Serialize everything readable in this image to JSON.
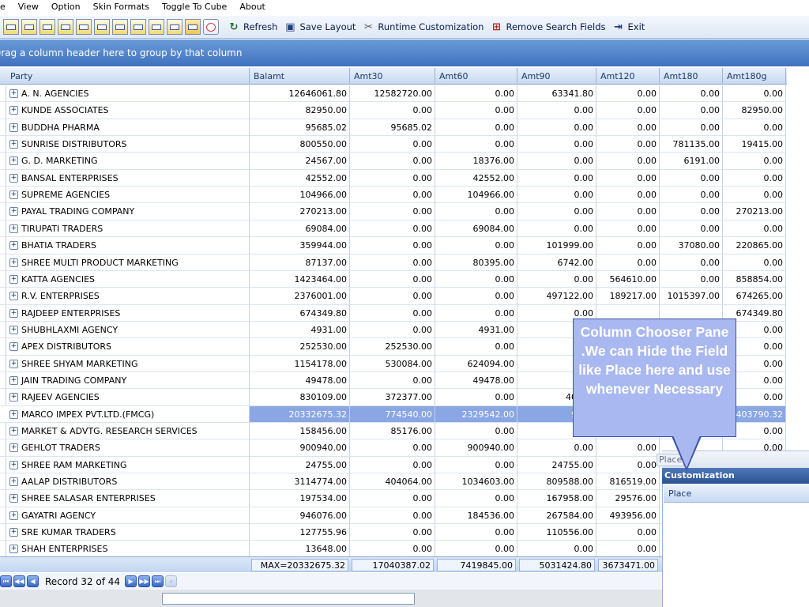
{
  "menu": [
    "e",
    "View",
    "Option",
    "Skin Formats",
    "Toggle To Cube",
    "About"
  ],
  "toolbar": {
    "buttons": [
      {
        "icon": "refresh-icon",
        "glyph": "↻",
        "label": "Refresh"
      },
      {
        "icon": "save-layout-icon",
        "glyph": "▣",
        "label": "Save Layout"
      },
      {
        "icon": "tools-icon",
        "glyph": "✂",
        "label": "Runtime Customization"
      },
      {
        "icon": "remove-fields-icon",
        "glyph": "⊞",
        "label": "Remove Search Fields"
      },
      {
        "icon": "exit-icon",
        "glyph": "⇥",
        "label": "Exit"
      }
    ]
  },
  "group_panel": "Drag a column header here to group by that column",
  "columns": [
    "Party",
    "Balamt",
    "Amt30",
    "Amt60",
    "Amt90",
    "Amt120",
    "Amt180",
    "Amt180g"
  ],
  "rows": [
    [
      "A. N. AGENCIES",
      "12646061.80",
      "12582720.00",
      "0.00",
      "63341.80",
      "0.00",
      "0.00",
      "0.00"
    ],
    [
      "KUNDE ASSOCIATES",
      "82950.00",
      "0.00",
      "0.00",
      "0.00",
      "0.00",
      "0.00",
      "82950.00"
    ],
    [
      "BUDDHA PHARMA",
      "95685.02",
      "95685.02",
      "0.00",
      "0.00",
      "0.00",
      "0.00",
      "0.00"
    ],
    [
      "SUNRISE DISTRIBUTORS",
      "800550.00",
      "0.00",
      "0.00",
      "0.00",
      "0.00",
      "781135.00",
      "19415.00"
    ],
    [
      "G. D. MARKETING",
      "24567.00",
      "0.00",
      "18376.00",
      "0.00",
      "0.00",
      "6191.00",
      "0.00"
    ],
    [
      "BANSAL ENTERPRISES",
      "42552.00",
      "0.00",
      "42552.00",
      "0.00",
      "0.00",
      "0.00",
      "0.00"
    ],
    [
      "SUPREME AGENCIES",
      "104966.00",
      "0.00",
      "104966.00",
      "0.00",
      "0.00",
      "0.00",
      "0.00"
    ],
    [
      "PAYAL TRADING COMPANY",
      "270213.00",
      "0.00",
      "0.00",
      "0.00",
      "0.00",
      "0.00",
      "270213.00"
    ],
    [
      "TIRUPATI TRADERS",
      "69084.00",
      "0.00",
      "69084.00",
      "0.00",
      "0.00",
      "0.00",
      "0.00"
    ],
    [
      "BHATIA TRADERS",
      "359944.00",
      "0.00",
      "0.00",
      "101999.00",
      "0.00",
      "37080.00",
      "220865.00"
    ],
    [
      "SHREE MULTI PRODUCT MARKETING",
      "87137.00",
      "0.00",
      "80395.00",
      "6742.00",
      "0.00",
      "0.00",
      "0.00"
    ],
    [
      "KATTA AGENCIES",
      "1423464.00",
      "0.00",
      "0.00",
      "0.00",
      "564610.00",
      "0.00",
      "858854.00"
    ],
    [
      "R.V. ENTERPRISES",
      "2376001.00",
      "0.00",
      "0.00",
      "497122.00",
      "189217.00",
      "1015397.00",
      "674265.00"
    ],
    [
      "RAJDEEP ENTERPRISES",
      "674349.80",
      "0.00",
      "0.00",
      "0.00",
      "",
      "",
      "674349.80"
    ],
    [
      "SHUBHLAXMI AGENCY",
      "4931.00",
      "0.00",
      "4931.00",
      "",
      "",
      "",
      "0.00"
    ],
    [
      "APEX DISTRIBUTORS",
      "252530.00",
      "252530.00",
      "0.00",
      "",
      "",
      "",
      "0.00"
    ],
    [
      "SHREE SHYAM MARKETING",
      "1154178.00",
      "530084.00",
      "624094.00",
      "",
      "",
      "",
      "0.00"
    ],
    [
      "JAIN TRADING COMPANY",
      "49478.00",
      "0.00",
      "49478.00",
      "",
      "",
      "",
      "0.00"
    ],
    [
      "RAJEEV AGENCIES",
      "830109.00",
      "372377.00",
      "0.00",
      "40595",
      "",
      "",
      "0.00"
    ],
    [
      "MARCO IMPEX PVT.LTD.(FMCG)",
      "20332675.32",
      "774540.00",
      "2329542.00",
      "9889",
      "",
      "",
      "0403790.32"
    ],
    [
      "MARKET & ADVTG. RESEARCH SERVICES",
      "158456.00",
      "85176.00",
      "0.00",
      "",
      "",
      "",
      "0.00"
    ],
    [
      "GEHLOT TRADERS",
      "900940.00",
      "0.00",
      "900940.00",
      "0.00",
      "0.00",
      "",
      "0.00"
    ],
    [
      "SHREE RAM MARKETING",
      "24755.00",
      "0.00",
      "0.00",
      "24755.00",
      "0.00",
      "",
      "0.00"
    ],
    [
      "AALAP DISTRIBUTORS",
      "3114774.00",
      "404064.00",
      "1034603.00",
      "809588.00",
      "816519.00",
      "",
      ""
    ],
    [
      "SHREE SALASAR ENTERPRISES",
      "197534.00",
      "0.00",
      "0.00",
      "167958.00",
      "29576.00",
      "",
      ""
    ],
    [
      "GAYATRI AGENCY",
      "946076.00",
      "0.00",
      "184536.00",
      "267584.00",
      "493956.00",
      "",
      ""
    ],
    [
      "SRE KUMAR TRADERS",
      "127755.96",
      "0.00",
      "0.00",
      "110556.00",
      "0.00",
      "",
      ""
    ],
    [
      "SHAH ENTERPRISES",
      "13648.00",
      "0.00",
      "0.00",
      "0.00",
      "0.00",
      "",
      ""
    ]
  ],
  "selected_row": 19,
  "summary": [
    "MAX=20332675.32",
    "17040387.02",
    "7419845.00",
    "5031424.80",
    "3673471.00"
  ],
  "navigator": {
    "record_text": "Record 32 of 44"
  },
  "customization": {
    "title": "Customization",
    "field": "Place",
    "ghost": "Place"
  },
  "callout": {
    "text": "Column Chooser Pane .We can Hide the Field like Place here and use whenever Necessary"
  },
  "colors": {
    "accent": "#3f72bf",
    "selection": "#8aa6e4",
    "callout": "#a9b8f0"
  }
}
